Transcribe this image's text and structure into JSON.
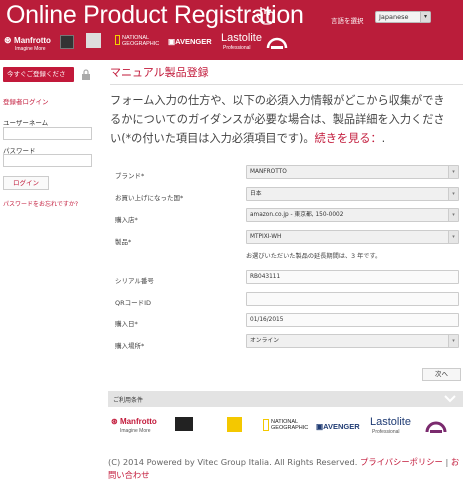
{
  "header": {
    "title": "Online Product Registration",
    "language_label": "言語を選択",
    "language_value": "Japanese",
    "brands": [
      "Manfrotto",
      "Imagine More",
      "NATIONAL GEOGRAPHIC",
      "AVENGER",
      "Lastolite",
      "Professional"
    ]
  },
  "sidebar": {
    "register_now": "今すぐご登録くださ",
    "registered_login": "登録者ログイン",
    "username_label": "ユーザーネーム",
    "password_label": "パスワード",
    "login_button": "ログイン",
    "forgot_password": "パスワードをお忘れですか?"
  },
  "main": {
    "page_title": "マニュアル製品登録",
    "intro_text": "フォーム入力の仕方や、以下の必須入力情報が必要な場合は、製品詳細を入力ください。どこから収集がかかるかについてのガイダンスが必要な場合は、製品詳細を入力ください(*の付いた項目は入力必須項目です)。",
    "intro_line1": "フォーム入力の仕方や、以下の必須入力情報がどこから収集ができ",
    "intro_line2": "るかについてのガイダンスが必要な場合は、製品詳細を入力くださ",
    "intro_line3": "い(*の付いた項目は入力必須項目です)。",
    "read_more": "続きを見る：",
    "read_more_suffix": "."
  },
  "form": {
    "brand_label": "ブランド*",
    "brand_value": "MANFROTTO",
    "country_label": "お買い上げになった国*",
    "country_value": "日本",
    "store_label": "購入店*",
    "store_value": "amazon.co.jp - 東京都, 150-0002",
    "product_label": "製品*",
    "product_value": "MTPIXI-WH",
    "warranty_note": "お選びいただいた製品の延長期間は、3 年です。",
    "serial_label": "シリアル番号",
    "serial_value": "RB043111",
    "qr_label": "QRコードID",
    "qr_value": "",
    "date_label": "購入日*",
    "date_value": "01/16/2015",
    "place_label": "購入場所*",
    "place_value": "オンライン",
    "next_button": "次へ"
  },
  "terms": {
    "label": "ご利用条件"
  },
  "footer": {
    "copyright": "(C) 2014 Powered by Vitec Group Italia. All Rights Reserved.",
    "privacy_policy": "プライバシーポリシー",
    "separator": "|",
    "contact": "お問い合わせ"
  },
  "colors": {
    "brand_red": "#ba1d3a",
    "link_red": "#c2193a"
  }
}
